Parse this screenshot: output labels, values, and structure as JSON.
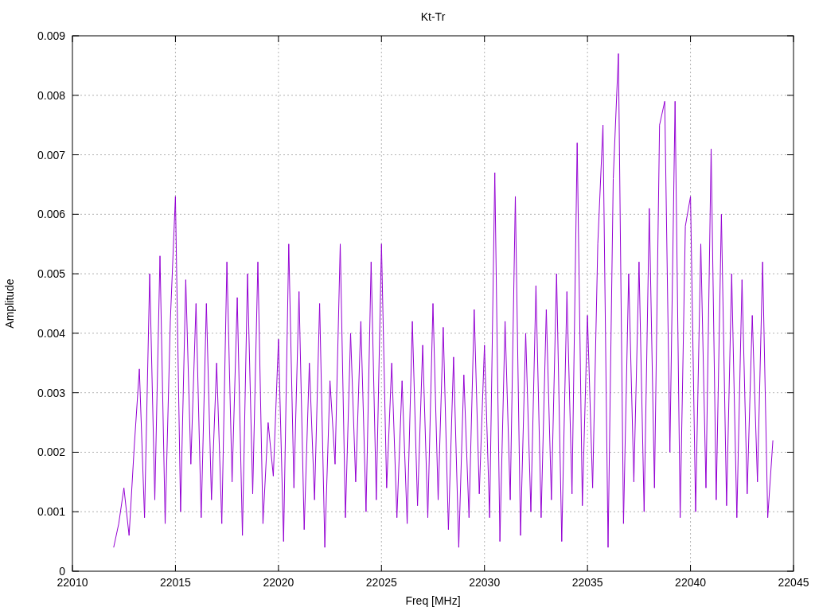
{
  "plot": {
    "chart_data": {
      "type": "line",
      "title": "Kt-Tr",
      "xlabel": "Freq [MHz]",
      "ylabel": "Amplitude",
      "xlim": [
        22010,
        22045
      ],
      "ylim": [
        0,
        0.009
      ],
      "grid": true,
      "xticks": [
        22010,
        22015,
        22020,
        22025,
        22030,
        22035,
        22040,
        22045
      ],
      "yticks": [
        0,
        0.001,
        0.002,
        0.003,
        0.004,
        0.005,
        0.006,
        0.007,
        0.008,
        0.009
      ],
      "x": [
        22012,
        22012.25,
        22012.5,
        22012.75,
        22013,
        22013.25,
        22013.5,
        22013.75,
        22014,
        22014.25,
        22014.5,
        22014.75,
        22015,
        22015.25,
        22015.5,
        22015.75,
        22016,
        22016.25,
        22016.5,
        22016.75,
        22017,
        22017.25,
        22017.5,
        22017.75,
        22018,
        22018.25,
        22018.5,
        22018.75,
        22019,
        22019.25,
        22019.5,
        22019.75,
        22020,
        22020.25,
        22020.5,
        22020.75,
        22021,
        22021.25,
        22021.5,
        22021.75,
        22022,
        22022.25,
        22022.5,
        22022.75,
        22023,
        22023.25,
        22023.5,
        22023.75,
        22024,
        22024.25,
        22024.5,
        22024.75,
        22025,
        22025.25,
        22025.5,
        22025.75,
        22026,
        22026.25,
        22026.5,
        22026.75,
        22027,
        22027.25,
        22027.5,
        22027.75,
        22028,
        22028.25,
        22028.5,
        22028.75,
        22029,
        22029.25,
        22029.5,
        22029.75,
        22030,
        22030.25,
        22030.5,
        22030.75,
        22031,
        22031.25,
        22031.5,
        22031.75,
        22032,
        22032.25,
        22032.5,
        22032.75,
        22033,
        22033.25,
        22033.5,
        22033.75,
        22034,
        22034.25,
        22034.5,
        22034.75,
        22035,
        22035.25,
        22035.5,
        22035.75,
        22036,
        22036.25,
        22036.5,
        22036.75,
        22037,
        22037.25,
        22037.5,
        22037.75,
        22038,
        22038.25,
        22038.5,
        22038.75,
        22039,
        22039.25,
        22039.5,
        22039.75,
        22040,
        22040.25,
        22040.5,
        22040.75,
        22041,
        22041.25,
        22041.5,
        22041.75,
        22042,
        22042.25,
        22042.5,
        22042.75,
        22043,
        22043.25,
        22043.5,
        22043.75,
        22044
      ],
      "series": [
        {
          "color": "#9400d3",
          "values": [
            0.0004,
            0.0008,
            0.0014,
            0.0006,
            0.0021,
            0.0034,
            0.0009,
            0.005,
            0.0012,
            0.0053,
            0.0008,
            0.0042,
            0.0063,
            0.001,
            0.0049,
            0.0018,
            0.0045,
            0.0009,
            0.0045,
            0.0012,
            0.0035,
            0.0008,
            0.0052,
            0.0015,
            0.0046,
            0.0006,
            0.005,
            0.0013,
            0.0052,
            0.0008,
            0.0025,
            0.0016,
            0.0039,
            0.0005,
            0.0055,
            0.0014,
            0.0047,
            0.0007,
            0.0035,
            0.0012,
            0.0045,
            0.0004,
            0.0032,
            0.0018,
            0.0055,
            0.0009,
            0.004,
            0.0015,
            0.0042,
            0.001,
            0.0052,
            0.0012,
            0.0055,
            0.0014,
            0.0035,
            0.0009,
            0.0032,
            0.0008,
            0.0042,
            0.0011,
            0.0038,
            0.0009,
            0.0045,
            0.0012,
            0.0041,
            0.0007,
            0.0036,
            0.0004,
            0.0033,
            0.0009,
            0.0044,
            0.0013,
            0.0038,
            0.0009,
            0.0067,
            0.0005,
            0.0042,
            0.0012,
            0.0063,
            0.0006,
            0.004,
            0.001,
            0.0048,
            0.0009,
            0.0044,
            0.0012,
            0.005,
            0.0005,
            0.0047,
            0.0013,
            0.0072,
            0.0011,
            0.0043,
            0.0014,
            0.0055,
            0.0075,
            0.0004,
            0.0066,
            0.0087,
            0.0008,
            0.005,
            0.0015,
            0.0052,
            0.001,
            0.0061,
            0.0014,
            0.0075,
            0.0079,
            0.002,
            0.0079,
            0.0009,
            0.0058,
            0.0063,
            0.001,
            0.0055,
            0.0014,
            0.0071,
            0.0012,
            0.006,
            0.0011,
            0.005,
            0.0009,
            0.0049,
            0.0013,
            0.0043,
            0.0015,
            0.0052,
            0.0009,
            0.0022
          ]
        }
      ]
    }
  }
}
